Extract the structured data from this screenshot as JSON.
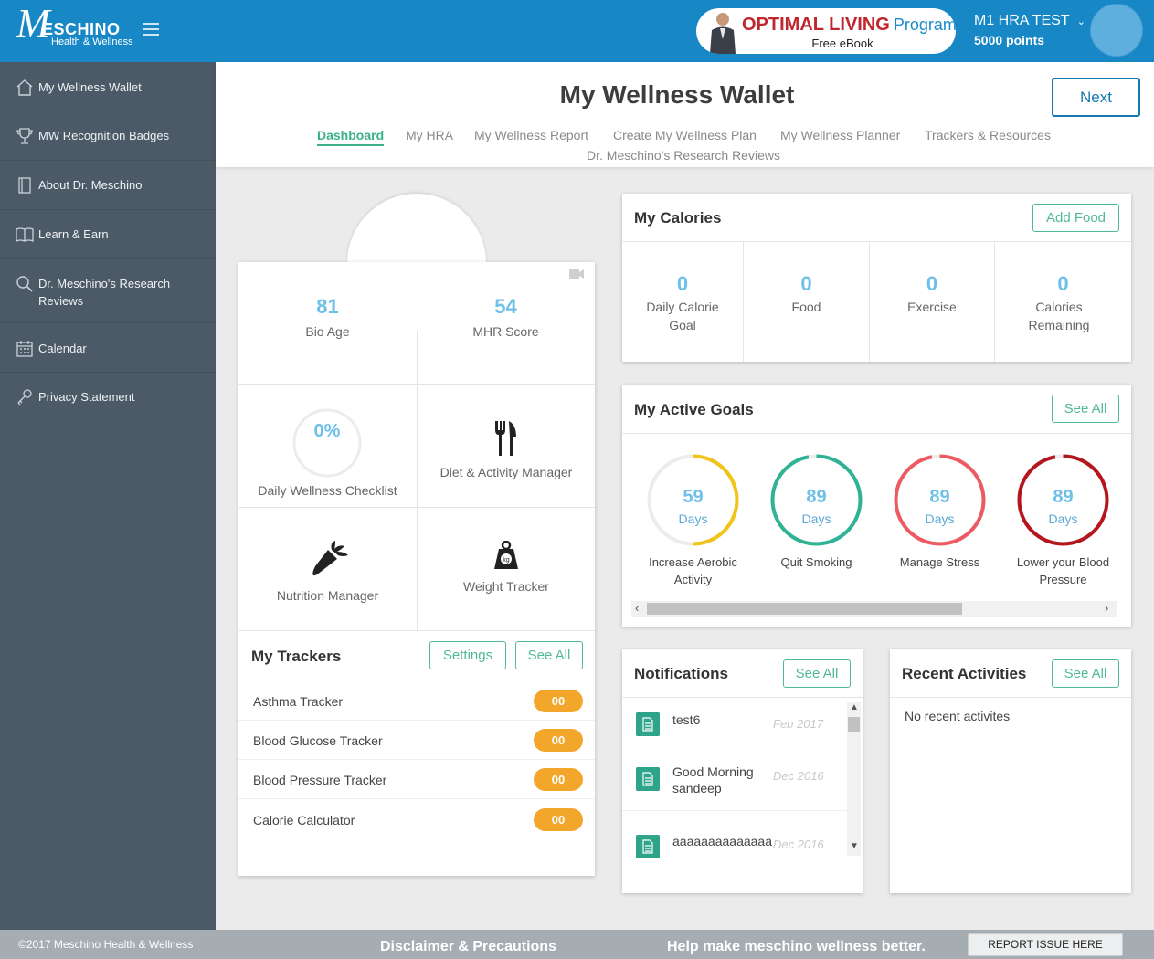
{
  "brand": {
    "line1": "ESCHINO",
    "line2": "Health & Wellness"
  },
  "ebook": {
    "title": "OPTIMAL LIVING",
    "title_suffix": "Program",
    "subtitle": "Free eBook"
  },
  "user": {
    "name": "M1 HRA TEST",
    "points": "5000 points"
  },
  "sidebar": {
    "items": [
      {
        "label": "My Wellness Wallet",
        "icon": "home-icon"
      },
      {
        "label": "MW Recognition Badges",
        "icon": "trophy-icon"
      },
      {
        "label": "About Dr. Meschino",
        "icon": "book-icon"
      },
      {
        "label": "Learn & Earn",
        "icon": "open-book-icon"
      },
      {
        "label": "Dr. Meschino's Research Reviews",
        "icon": "search-icon"
      },
      {
        "label": "Calendar",
        "icon": "calendar-icon"
      },
      {
        "label": "Privacy Statement",
        "icon": "key-icon"
      }
    ]
  },
  "page": {
    "title": "My Wellness Wallet",
    "next_label": "Next"
  },
  "tabs": [
    {
      "label": "Dashboard",
      "active": true
    },
    {
      "label": "My HRA"
    },
    {
      "label": "My Wellness Report"
    },
    {
      "label": "Create My Wellness Plan"
    },
    {
      "label": "My Wellness Planner"
    },
    {
      "label": "Trackers & Resources"
    },
    {
      "label": "Dr. Meschino's Research Reviews"
    }
  ],
  "health": {
    "bio_age": {
      "value": "81",
      "label": "Bio Age"
    },
    "mhr": {
      "value": "54",
      "label": "MHR Score"
    },
    "checklist": {
      "value": "0%",
      "label": "Daily Wellness Checklist"
    },
    "diet_label": "Diet & Activity Manager",
    "nutrition_label": "Nutrition Manager",
    "weight_label": "Weight Tracker"
  },
  "trackers": {
    "title": "My Trackers",
    "settings_label": "Settings",
    "see_all_label": "See All",
    "items": [
      {
        "name": "Asthma Tracker",
        "count": "00"
      },
      {
        "name": "Blood Glucose Tracker",
        "count": "00"
      },
      {
        "name": "Blood Pressure Tracker",
        "count": "00"
      },
      {
        "name": "Calorie Calculator",
        "count": "00"
      }
    ]
  },
  "calories": {
    "title": "My Calories",
    "add_label": "Add Food",
    "stats": [
      {
        "value": "0",
        "label": "Daily Calorie Goal"
      },
      {
        "value": "0",
        "label": "Food"
      },
      {
        "value": "0",
        "label": "Exercise"
      },
      {
        "value": "0",
        "label": "Calories Remaining"
      }
    ]
  },
  "goals": {
    "title": "My Active Goals",
    "see_all_label": "See All",
    "items": [
      {
        "days": "59",
        "unit": "Days",
        "label": "Increase Aerobic Activity",
        "color": "#f0c419",
        "progress": 0.5
      },
      {
        "days": "89",
        "unit": "Days",
        "label": "Quit Smoking",
        "color": "#2fb296",
        "progress": 0.97
      },
      {
        "days": "89",
        "unit": "Days",
        "label": "Manage Stress",
        "color": "#ec5b62",
        "progress": 0.97
      },
      {
        "days": "89",
        "unit": "Days",
        "label": "Lower your Blood Pressure",
        "color": "#b3171d",
        "progress": 0.97
      }
    ]
  },
  "notifications": {
    "title": "Notifications",
    "see_all_label": "See All",
    "items": [
      {
        "text": "test6",
        "date": "Feb 2017"
      },
      {
        "text": "Good Morning sandeep",
        "date": "Dec 2016"
      },
      {
        "text": "aaaaaaaaaaaaaa",
        "date": "Dec 2016"
      }
    ]
  },
  "recent": {
    "title": "Recent Activities",
    "see_all_label": "See All",
    "empty_text": "No recent activites"
  },
  "footer": {
    "copyright": "©2017 Meschino Health & Wellness",
    "disclaimer": "Disclaimer & Precautions",
    "help": "Help make meschino wellness better.",
    "report_label": "REPORT ISSUE HERE"
  }
}
